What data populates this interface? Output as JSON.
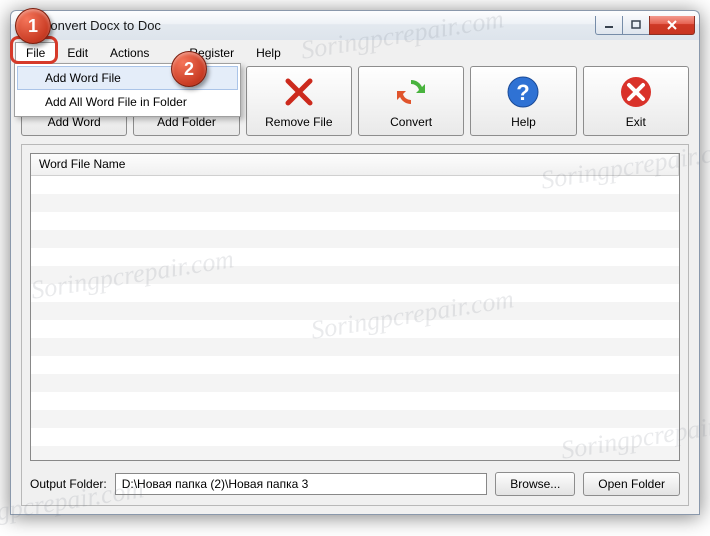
{
  "title": "Convert Docx to Doc",
  "menubar": {
    "file": "File",
    "edit": "Edit",
    "actions": "Actions",
    "register": "Register",
    "help": "Help"
  },
  "dropdown": {
    "add_file": "Add Word File",
    "add_folder": "Add All Word File in Folder"
  },
  "toolbar": {
    "add_word": "Add Word",
    "add_folder": "Add Folder",
    "remove_file": "Remove File",
    "convert": "Convert",
    "help": "Help",
    "exit": "Exit"
  },
  "list": {
    "header": "Word File Name"
  },
  "output": {
    "label": "Output Folder:",
    "path": "D:\\Новая папка (2)\\Новая папка 3",
    "browse": "Browse...",
    "open": "Open Folder"
  },
  "callouts": {
    "c1": "1",
    "c2": "2"
  },
  "watermark": "Soringpcrepair.com"
}
